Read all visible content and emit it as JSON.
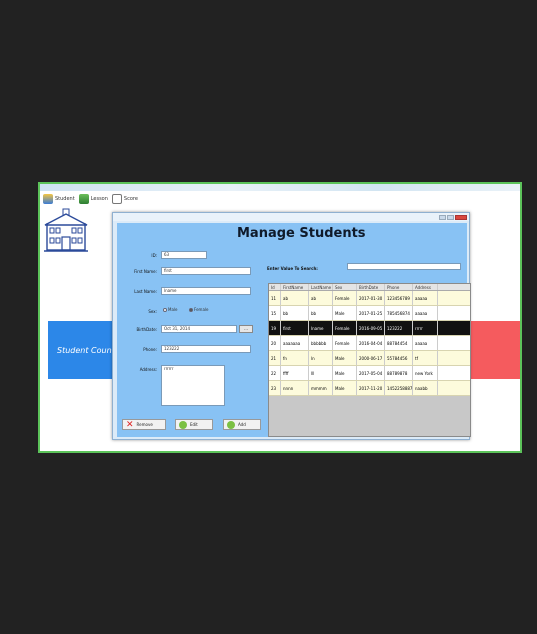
{
  "menu": {
    "items": [
      {
        "label": "Student",
        "icon": "student-icon"
      },
      {
        "label": "Lesson",
        "icon": "lesson-icon"
      },
      {
        "label": "Score",
        "icon": "score-icon"
      }
    ]
  },
  "dashboard": {
    "tile_label": "Student Count"
  },
  "form": {
    "title": "Manage Students",
    "id_label": "ID:",
    "id_value": "63",
    "first_name_label": "First Name:",
    "first_name_value": "first",
    "last_name_label": "Last Name:",
    "last_name_value": "lname",
    "sex_label": "Sex:",
    "sex_options": [
      "Male",
      "Female"
    ],
    "sex_selected": "Female",
    "birthdate_label": "BirthDate:",
    "birthdate_value": "Oct 31, 2014",
    "date_button": "...",
    "phone_label": "Phone:",
    "phone_value": "123222",
    "address_label": "Address:",
    "address_value": "rrrrrr",
    "remove_label": "Remove",
    "edit_label": "Edit",
    "add_label": "Add"
  },
  "search": {
    "label": "Enter Value To Search:",
    "value": ""
  },
  "table": {
    "columns": [
      "Id",
      "FirstName",
      "LastName",
      "Sex",
      "BirthDate",
      "Phone",
      "Address"
    ],
    "rows": [
      {
        "cells": [
          "11",
          "ab",
          "ab",
          "Female",
          "2017-01-30",
          "123456789",
          "aaaaa"
        ],
        "style": "normal"
      },
      {
        "cells": [
          "15",
          "bb",
          "bb",
          "Male",
          "2017-01-25",
          "785456874",
          "aaaaa"
        ],
        "style": "alt"
      },
      {
        "cells": [
          "19",
          "first",
          "lname",
          "Female",
          "2016-09-05",
          "123222",
          "rrrrr"
        ],
        "style": "sel"
      },
      {
        "cells": [
          "20",
          "aaaaaaa",
          "bbbbbb",
          "Female",
          "2016-04-04",
          "88784454",
          "aaaaa"
        ],
        "style": "alt"
      },
      {
        "cells": [
          "21",
          "fn",
          "ln",
          "Male",
          "2000-06-17",
          "55784456",
          "tf"
        ],
        "style": "normal"
      },
      {
        "cells": [
          "22",
          "ffff",
          "lll",
          "Male",
          "2017-05-04",
          "88789878",
          "new York"
        ],
        "style": "alt"
      },
      {
        "cells": [
          "23",
          "nnnn",
          "mmmm",
          "Male",
          "2017-11-20",
          "1452258887",
          "naabb"
        ],
        "style": "normal"
      }
    ]
  },
  "colors": {
    "frame_border": "#5cc35a",
    "panel_bg": "#88c2f4",
    "blue_tile": "#2c87e8",
    "red_tile": "#f55b5e",
    "selected_row": "#111111"
  }
}
